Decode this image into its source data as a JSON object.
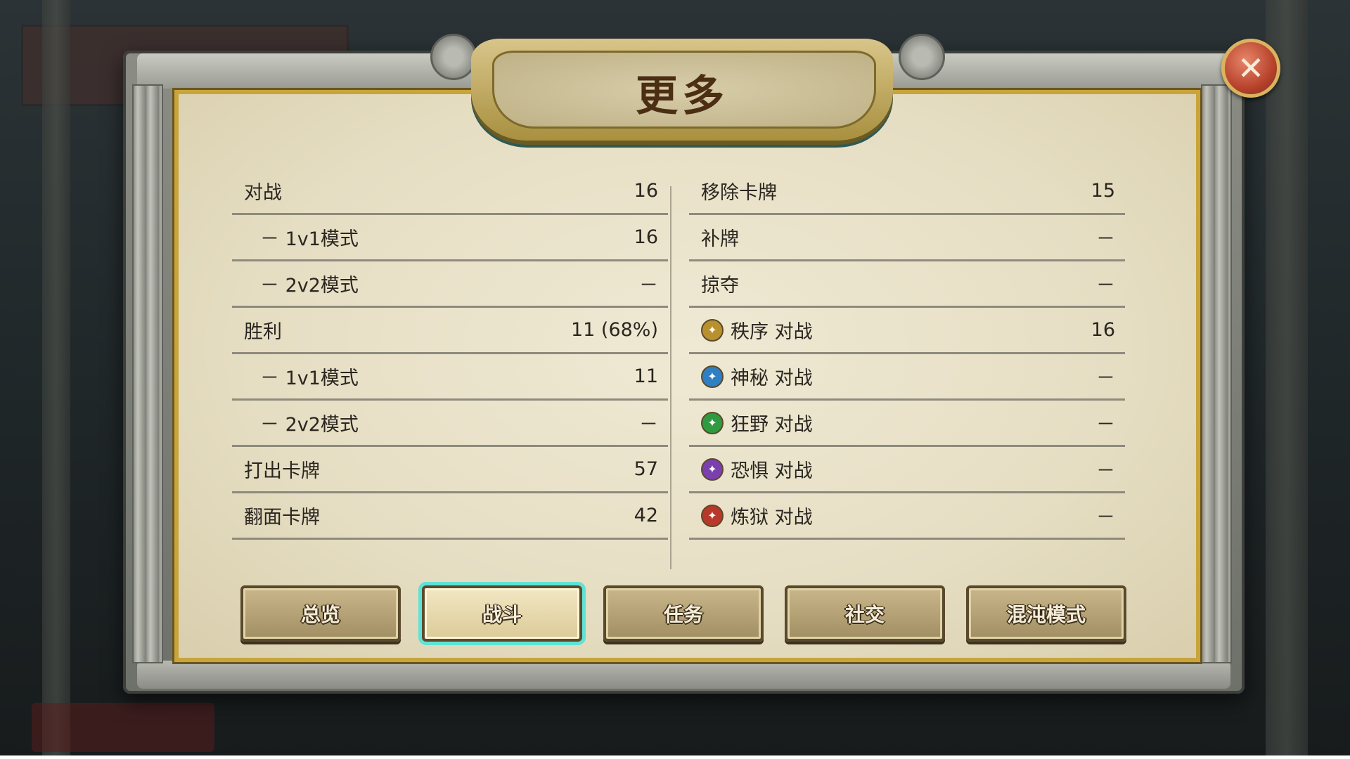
{
  "title": "更多",
  "close_label": "✕",
  "left_stats": [
    {
      "label": "对战",
      "value": "16",
      "indent": false
    },
    {
      "label": "－ 1v1模式",
      "value": "16",
      "indent": true
    },
    {
      "label": "－ 2v2模式",
      "value": "－",
      "indent": true
    },
    {
      "label": "胜利",
      "value": "11 (68%)",
      "indent": false
    },
    {
      "label": "－ 1v1模式",
      "value": "11",
      "indent": true
    },
    {
      "label": "－ 2v2模式",
      "value": "－",
      "indent": true
    },
    {
      "label": "打出卡牌",
      "value": "57",
      "indent": false
    },
    {
      "label": "翻面卡牌",
      "value": "42",
      "indent": false
    }
  ],
  "right_stats": [
    {
      "label": "移除卡牌",
      "value": "15",
      "icon": null
    },
    {
      "label": "补牌",
      "value": "－",
      "icon": null
    },
    {
      "label": "掠夺",
      "value": "－",
      "icon": null
    },
    {
      "label": "秩序 对战",
      "value": "16",
      "icon": "order-faction-icon",
      "icon_color": "#b8902e"
    },
    {
      "label": "神秘 对战",
      "value": "－",
      "icon": "mystic-faction-icon",
      "icon_color": "#2f7fc4"
    },
    {
      "label": "狂野 对战",
      "value": "－",
      "icon": "wild-faction-icon",
      "icon_color": "#2f9a3f"
    },
    {
      "label": "恐惧 对战",
      "value": "－",
      "icon": "dread-faction-icon",
      "icon_color": "#7b3fae"
    },
    {
      "label": "炼狱 对战",
      "value": "－",
      "icon": "inferno-faction-icon",
      "icon_color": "#b8392b"
    }
  ],
  "tabs": [
    {
      "label": "总览",
      "active": false
    },
    {
      "label": "战斗",
      "active": true
    },
    {
      "label": "任务",
      "active": false
    },
    {
      "label": "社交",
      "active": false
    },
    {
      "label": "混沌模式",
      "active": false
    }
  ],
  "colors": {
    "parchment": "#e8e1c8",
    "gold_border": "#c8a43a",
    "active_tab_glow": "#5fe3d6",
    "close_button": "#c0472f"
  }
}
